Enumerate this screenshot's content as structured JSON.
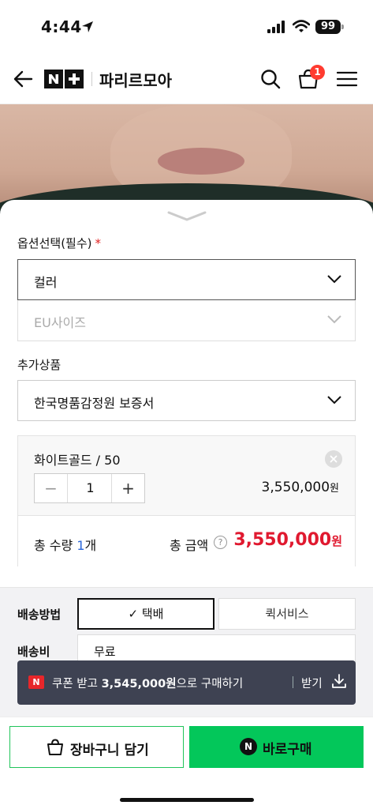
{
  "status_bar": {
    "time": "4:44",
    "battery": "99"
  },
  "header": {
    "logo_text": "N+",
    "store_name": "파리르모아",
    "cart_count": "1"
  },
  "options": {
    "label": "옵션선택(필수)",
    "required_mark": "*",
    "color_select": "컬러",
    "size_select": "EU사이즈"
  },
  "addon": {
    "label": "추가상품",
    "select": "한국명품감정원 보증서"
  },
  "selected_item": {
    "name": "화이트골드 / 50",
    "quantity": "1",
    "minus": "−",
    "plus": "+",
    "price": "3,550,000",
    "price_unit": "원"
  },
  "total": {
    "qty_label": "총 수량",
    "qty_value": "1",
    "qty_unit": "개",
    "amount_label": "총 금액",
    "help": "?",
    "amount": "3,550,000",
    "amount_unit": "원"
  },
  "delivery": {
    "method_label": "배송방법",
    "options": [
      "✓ 택배",
      "퀵서비스"
    ],
    "fee_label": "배송비",
    "fee_value": "무료"
  },
  "coupon": {
    "badge": "N",
    "text_prefix": "쿠폰 받고 ",
    "amount": "3,545,000원",
    "text_suffix": "으로 구매하기",
    "get_label": "받기"
  },
  "buttons": {
    "cart": "장바구니 담기",
    "buy_badge": "N",
    "buy": "바로구매"
  },
  "colors": {
    "naver_green": "#03c75a",
    "price_red": "#e0192f",
    "badge_red": "#ff3b30"
  }
}
